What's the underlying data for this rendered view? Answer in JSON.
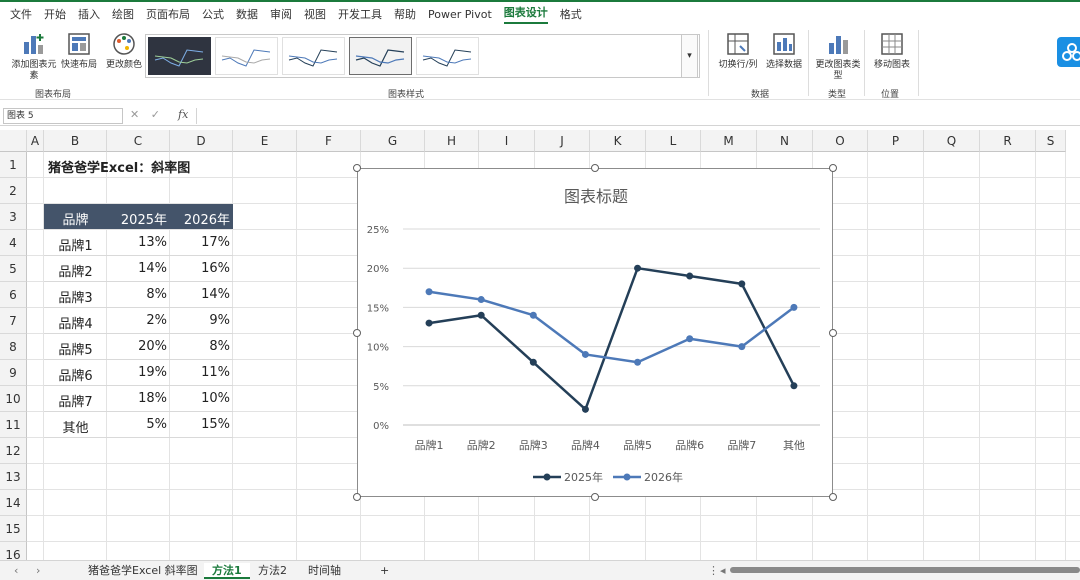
{
  "menu": [
    "文件",
    "开始",
    "插入",
    "绘图",
    "页面布局",
    "公式",
    "数据",
    "审阅",
    "视图",
    "开发工具",
    "帮助",
    "Power Pivot",
    "图表设计",
    "格式"
  ],
  "menu_active": "图表设计",
  "ribbon": {
    "add_element": "添加图表元素",
    "quick_layout": "快速布局",
    "change_color": "更改颜色",
    "switch_row_col": "切换行/列",
    "select_data": "选择数据",
    "change_type": "更改图表类型",
    "move_chart": "移动图表",
    "group_layout": "图表布局",
    "group_styles": "图表样式",
    "group_data": "数据",
    "group_type": "类型",
    "group_location": "位置",
    "gallery_more": "▾"
  },
  "formula_bar": {
    "name_box": "图表 5",
    "fx": "fx",
    "icons": "✕ ✓"
  },
  "columns": [
    "A",
    "B",
    "C",
    "D",
    "E",
    "F",
    "G",
    "H",
    "I",
    "J",
    "K",
    "L",
    "M",
    "N",
    "O",
    "P",
    "Q",
    "R",
    "S"
  ],
  "rows": [
    "1",
    "2",
    "3",
    "4",
    "5",
    "6",
    "7",
    "8",
    "9",
    "10",
    "11",
    "12",
    "13",
    "14",
    "15",
    "16"
  ],
  "sheet": {
    "title": "猪爸爸学Excel：斜率图",
    "table_headers": [
      "品牌",
      "2025年",
      "2026年"
    ],
    "table_rows": [
      [
        "品牌1",
        "13%",
        "17%"
      ],
      [
        "品牌2",
        "14%",
        "16%"
      ],
      [
        "品牌3",
        "8%",
        "14%"
      ],
      [
        "品牌4",
        "2%",
        "9%"
      ],
      [
        "品牌5",
        "20%",
        "8%"
      ],
      [
        "品牌6",
        "19%",
        "11%"
      ],
      [
        "品牌7",
        "18%",
        "10%"
      ],
      [
        "其他",
        "5%",
        "15%"
      ]
    ]
  },
  "chart_data": {
    "type": "line",
    "title": "图表标题",
    "categories": [
      "品牌1",
      "品牌2",
      "品牌3",
      "品牌4",
      "品牌5",
      "品牌6",
      "品牌7",
      "其他"
    ],
    "series": [
      {
        "name": "2025年",
        "values": [
          13,
          14,
          8,
          2,
          20,
          19,
          18,
          5
        ],
        "color": "#243f58"
      },
      {
        "name": "2026年",
        "values": [
          17,
          16,
          14,
          9,
          8,
          11,
          10,
          15
        ],
        "color": "#4d79b8"
      }
    ],
    "y_ticks": [
      "0%",
      "5%",
      "10%",
      "15%",
      "20%",
      "25%"
    ],
    "ylim": [
      0,
      25
    ],
    "grid": true,
    "legend": "bottom"
  },
  "tabs": [
    "猪爸爸学Excel 斜率图",
    "方法1",
    "方法2",
    "时间轴"
  ],
  "active_tab": "方法1",
  "tab_add": "+",
  "tab_nav": "⋮"
}
